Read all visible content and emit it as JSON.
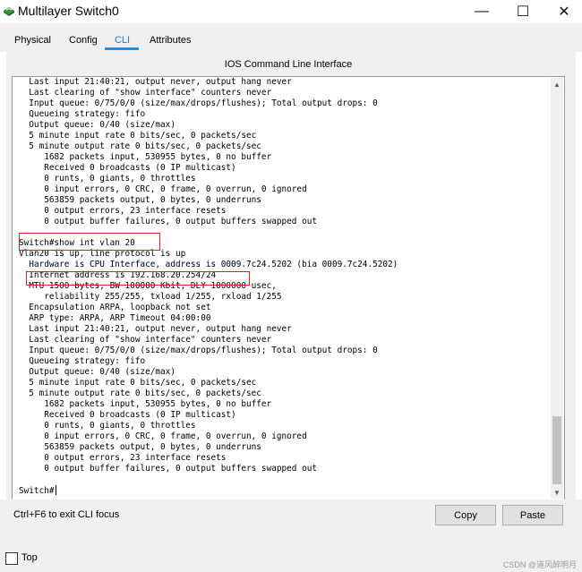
{
  "window": {
    "title": "Multilayer Switch0",
    "minimize_glyph": "—",
    "maximize_glyph": "☐",
    "close_glyph": "✕"
  },
  "tabs": [
    {
      "label": "Physical",
      "active": false
    },
    {
      "label": "Config",
      "active": false
    },
    {
      "label": "CLI",
      "active": true
    },
    {
      "label": "Attributes",
      "active": false
    }
  ],
  "panel_title": "IOS Command Line Interface",
  "cli_lines": [
    "  Last input 21:40:21, output never, output hang never",
    "  Last clearing of \"show interface\" counters never",
    "  Input queue: 0/75/0/0 (size/max/drops/flushes); Total output drops: 0",
    "  Queueing strategy: fifo",
    "  Output queue: 0/40 (size/max)",
    "  5 minute input rate 0 bits/sec, 0 packets/sec",
    "  5 minute output rate 0 bits/sec, 0 packets/sec",
    "     1682 packets input, 530955 bytes, 0 no buffer",
    "     Received 0 broadcasts (0 IP multicast)",
    "     0 runts, 0 giants, 0 throttles",
    "     0 input errors, 0 CRC, 0 frame, 0 overrun, 0 ignored",
    "     563859 packets output, 0 bytes, 0 underruns",
    "     0 output errors, 23 interface resets",
    "     0 output buffer failures, 0 output buffers swapped out",
    "",
    "Switch#show int vlan 20",
    "Vlan20 is up, line protocol is up",
    "  Hardware is CPU Interface, address is 0009.7c24.5202 (bia 0009.7c24.5202)",
    "  Internet address is 192.168.20.254/24",
    "  MTU 1500 bytes, BW 100000 Kbit, DLY 1000000 usec,",
    "     reliability 255/255, txload 1/255, rxload 1/255",
    "  Encapsulation ARPA, loopback not set",
    "  ARP type: ARPA, ARP Timeout 04:00:00",
    "  Last input 21:40:21, output never, output hang never",
    "  Last clearing of \"show interface\" counters never",
    "  Input queue: 0/75/0/0 (size/max/drops/flushes); Total output drops: 0",
    "  Queueing strategy: fifo",
    "  Output queue: 0/40 (size/max)",
    "  5 minute input rate 0 bits/sec, 0 packets/sec",
    "  5 minute output rate 0 bits/sec, 0 packets/sec",
    "     1682 packets input, 530955 bytes, 0 no buffer",
    "     Received 0 broadcasts (0 IP multicast)",
    "     0 runts, 0 giants, 0 throttles",
    "     0 input errors, 0 CRC, 0 frame, 0 overrun, 0 ignored",
    "     563859 packets output, 0 bytes, 0 underruns",
    "     0 output errors, 23 interface resets",
    "     0 output buffer failures, 0 output buffers swapped out",
    "",
    "Switch#"
  ],
  "hint": "Ctrl+F6 to exit CLI focus",
  "buttons": {
    "copy": "Copy",
    "paste": "Paste"
  },
  "top_checkbox": {
    "label": "Top",
    "checked": false
  },
  "watermark": "CSDN @道风醉明月",
  "colors": {
    "highlight": "#e0201c",
    "active_tab": "#1a7cd0"
  }
}
